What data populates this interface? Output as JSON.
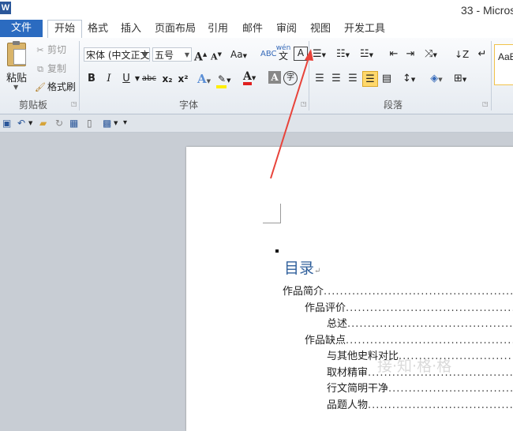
{
  "app": {
    "logo_letter": "W",
    "title": "33 - Micros"
  },
  "tabs": {
    "file": "文件",
    "home": "开始",
    "format": "格式",
    "insert": "插入",
    "page_layout": "页面布局",
    "references": "引用",
    "mailings": "邮件",
    "review": "审阅",
    "view": "视图",
    "developer": "开发工具"
  },
  "clipboard": {
    "paste": "粘贴",
    "cut": "剪切",
    "copy": "复制",
    "format_painter": "格式刷",
    "group_label": "剪贴板"
  },
  "font": {
    "font_name": "宋体 (中文正文)",
    "font_size": "五号",
    "group_label": "字体",
    "bold": "B",
    "italic": "I",
    "underline": "U",
    "strikethrough": "abc",
    "subscript": "x₂",
    "superscript": "x²",
    "grow": "A",
    "shrink": "A",
    "change_case": "Aa",
    "char_border": "A",
    "char_shading": "A",
    "enclose": "字",
    "phonetic": "wén",
    "phonetic_base": "文",
    "clear": "ABC",
    "highlight_color": "#ffee00",
    "font_color": "#e02020"
  },
  "paragraph": {
    "group_label": "段落"
  },
  "styles": {
    "preview": "AaB"
  },
  "quick_access": {
    "customize": "▾"
  },
  "document": {
    "toc_title": "目录",
    "toc_return_mark": "↵",
    "entries": [
      {
        "text": "作品简介",
        "level": 1
      },
      {
        "text": "作品评价",
        "level": 2
      },
      {
        "text": "总述",
        "level": 3
      },
      {
        "text": "作品缺点",
        "level": 2
      },
      {
        "text": "与其他史料对比",
        "level": 3
      },
      {
        "text": "取材精审",
        "level": 3
      },
      {
        "text": "行文简明干净",
        "level": 3
      },
      {
        "text": "品题人物",
        "level": 3
      }
    ],
    "leader": "................................................................................"
  },
  "watermark": "接·知·格·格",
  "annotation": {
    "arrow_color": "#e8433a"
  }
}
